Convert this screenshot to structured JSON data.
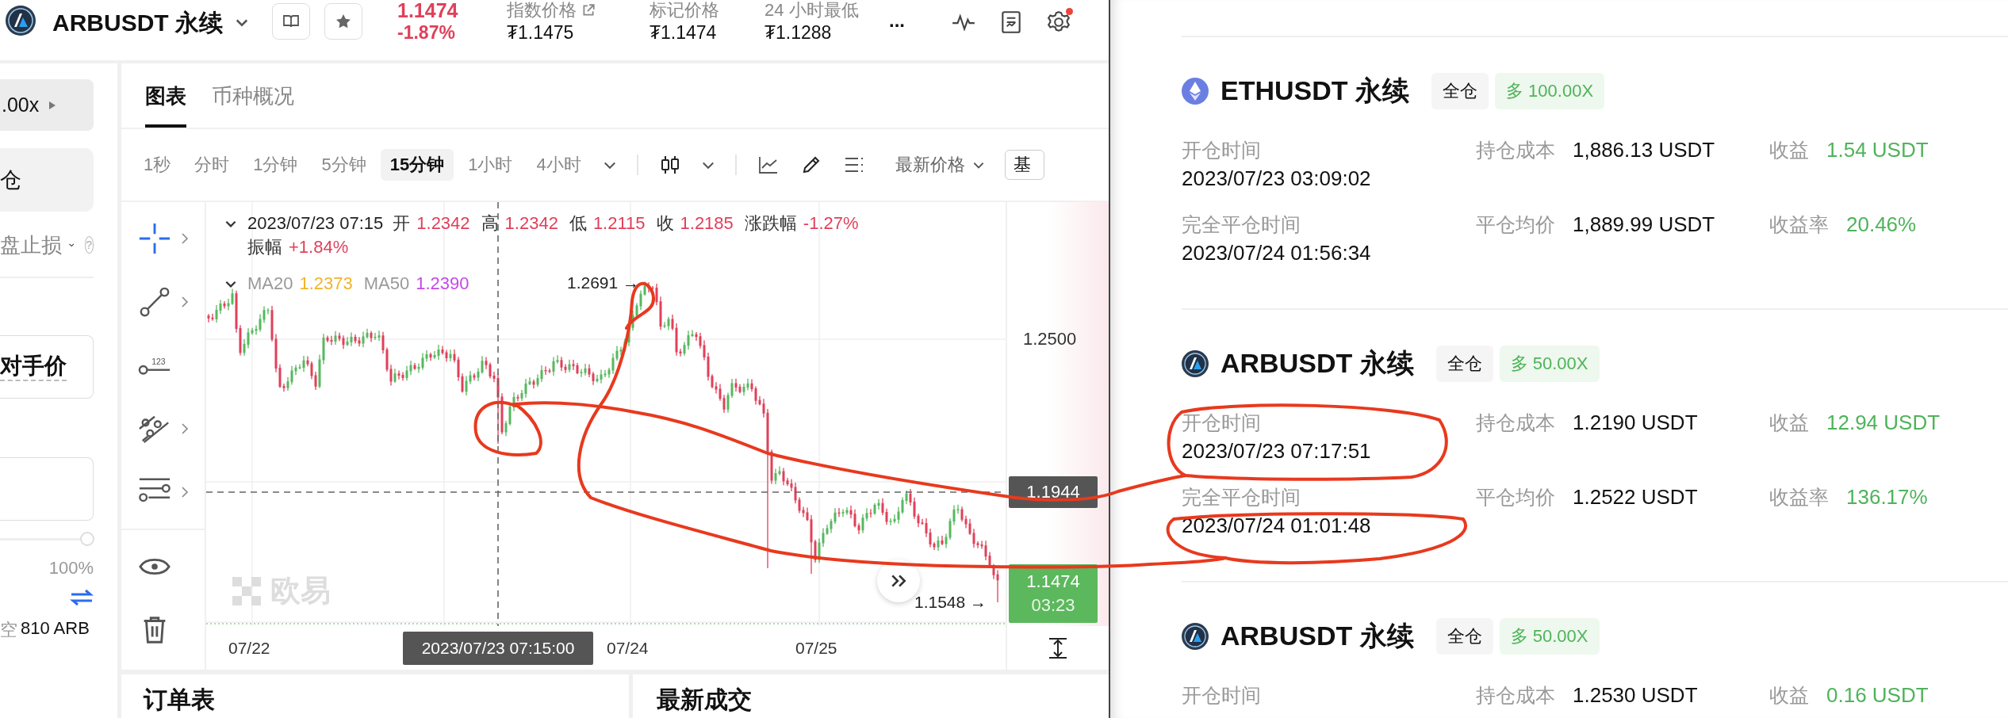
{
  "header": {
    "symbol": "ARBUSDT 永续",
    "last_price": "1.1474",
    "change": "-1.87%",
    "stats": [
      {
        "label": "指数价格",
        "value": "₮1.1475",
        "link": true
      },
      {
        "label": "标记价格",
        "value": "₮1.1474",
        "link": false
      },
      {
        "label": "24 小时最低",
        "value": "₮1.1288",
        "link": false
      }
    ],
    "more": "...",
    "settings_alert": true
  },
  "order_panel": {
    "leverage": ".00x",
    "margin_mode": "仓",
    "tpsl": "盘止损",
    "help": "?",
    "price_type": "对手价",
    "slider": {
      "level": 1
    },
    "max_label": "100%",
    "available_label": "空",
    "available_value": "810 ARB"
  },
  "chart_tabs": [
    {
      "label": "图表",
      "selected": true
    },
    {
      "label": "币种概况",
      "selected": false
    }
  ],
  "intervals": [
    {
      "label": "1秒",
      "selected": false
    },
    {
      "label": "分时",
      "selected": false
    },
    {
      "label": "1分钟",
      "selected": false
    },
    {
      "label": "5分钟",
      "selected": false
    },
    {
      "label": "15分钟",
      "selected": true
    },
    {
      "label": "1小时",
      "selected": false
    },
    {
      "label": "4小时",
      "selected": false
    }
  ],
  "price_source": "最新价格",
  "cut_button": "基",
  "price_line_tool": "123",
  "legend": {
    "time": "2023/07/23 07:15",
    "rows": [
      {
        "fields": [
          {
            "label": "开",
            "value": "1.2342"
          },
          {
            "label": "高",
            "value": "1.2342"
          },
          {
            "label": "低",
            "value": "1.2115"
          },
          {
            "label": "收",
            "value": "1.2185"
          },
          {
            "label": "涨跌幅",
            "value": "-1.27%"
          }
        ]
      },
      {
        "fields": [
          {
            "label": "振幅",
            "value": "+1.84%"
          }
        ]
      }
    ],
    "ma": [
      {
        "label": "MA20",
        "value": "1.2373",
        "color": "#f0b429"
      },
      {
        "label": "MA50",
        "value": "1.2390",
        "color": "#c548e8"
      }
    ]
  },
  "price_axis": [
    "1.2500"
  ],
  "crosshair_price": "1.1944",
  "last_price_badge": {
    "price": "1.1474",
    "countdown": "03:23"
  },
  "high_marker": "1.2691 →",
  "low_marker": "1.1548 →",
  "watermark": "欧易",
  "time_axis": [
    "07/22",
    "07/24",
    "07/25"
  ],
  "crosshair_time": "2023/07/23 07:15:00",
  "bottom_tabs": [
    "订单表",
    "最新成交"
  ],
  "positions": [
    {
      "kind": "eth",
      "symbol": "ETHUSDT 永续",
      "margin_tag": "全仓",
      "side_tag": "多 100.00X",
      "open_label": "开仓时间",
      "open_time": "2023/07/23 03:09:02",
      "cost_label": "持仓成本",
      "cost": "1,886.13 USDT",
      "pnl_label": "收益",
      "pnl": "1.54 USDT",
      "close_label": "完全平仓时间",
      "close_time": "2023/07/24 01:56:34",
      "avg_label": "平仓均价",
      "avg": "1,889.99 USDT",
      "rate_label": "收益率",
      "rate": "20.46%"
    },
    {
      "kind": "arb",
      "symbol": "ARBUSDT 永续",
      "margin_tag": "全仓",
      "side_tag": "多 50.00X",
      "open_label": "开仓时间",
      "open_time": "2023/07/23 07:17:51",
      "cost_label": "持仓成本",
      "cost": "1.2190 USDT",
      "pnl_label": "收益",
      "pnl": "12.94 USDT",
      "close_label": "完全平仓时间",
      "close_time": "2023/07/24 01:01:48",
      "avg_label": "平仓均价",
      "avg": "1.2522 USDT",
      "rate_label": "收益率",
      "rate": "136.17%"
    },
    {
      "kind": "arb",
      "symbol": "ARBUSDT 永续",
      "margin_tag": "全仓",
      "side_tag": "多 50.00X",
      "open_label": "开仓时间",
      "cost_label": "持仓成本",
      "cost": "1.2530 USDT",
      "pnl_label": "收益",
      "pnl": "0.16 USDT"
    }
  ]
}
